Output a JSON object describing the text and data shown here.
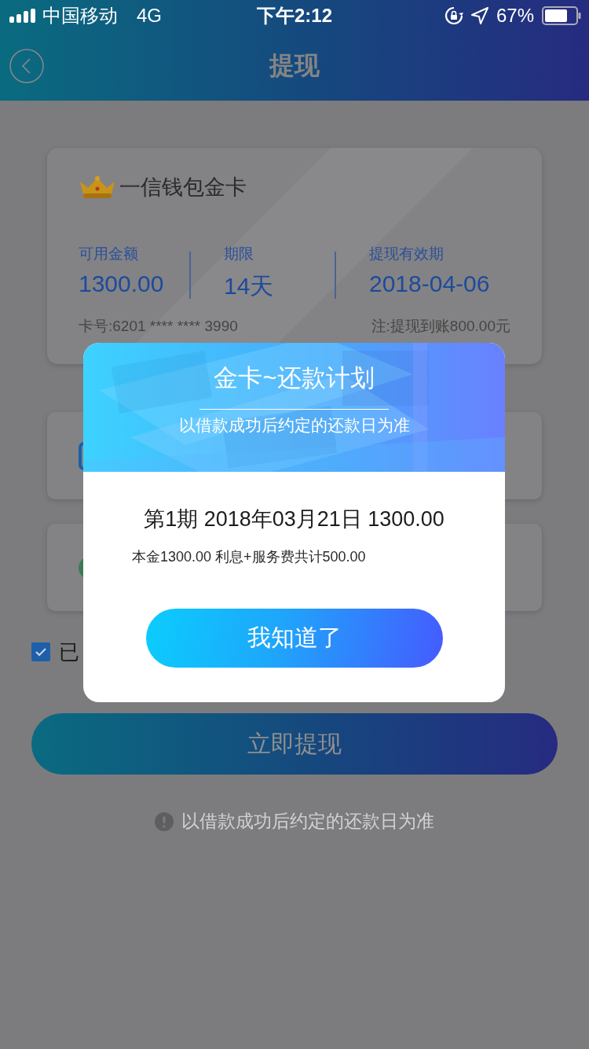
{
  "status_bar": {
    "carrier": "中国移动",
    "network": "4G",
    "time": "下午2:12",
    "battery": "67%"
  },
  "nav": {
    "title": "提现"
  },
  "card": {
    "name": "一信钱包金卡",
    "stats": [
      {
        "label": "可用金额",
        "value": "1300.00"
      },
      {
        "label": "期限",
        "value": "14天"
      },
      {
        "label": "提现有效期",
        "value": "2018-04-06"
      }
    ],
    "card_number": "卡号:6201 **** **** 3990",
    "note": "注:提现到账800.00元"
  },
  "options": [
    {
      "kind": "bank"
    },
    {
      "kind": "wallet"
    }
  ],
  "agreement": {
    "checked": true,
    "label": "已"
  },
  "submit": {
    "label": "立即提现"
  },
  "hint": "以借款成功后约定的还款日为准",
  "dialog": {
    "title": "金卡~还款计划",
    "subtitle": "以借款成功后约定的还款日为准",
    "installments": [
      {
        "line": "第1期 2018年03月21日 1300.00",
        "detail": "本金1300.00 利息+服务费共计500.00"
      }
    ],
    "button": "我知道了"
  }
}
